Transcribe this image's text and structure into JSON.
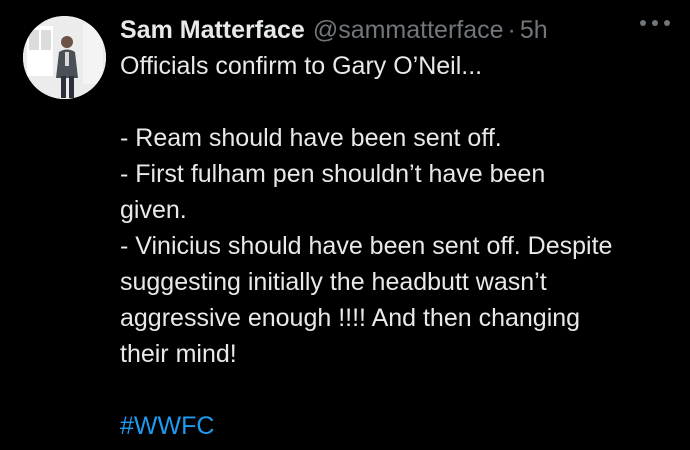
{
  "tweet": {
    "author_name": "Sam Matterface",
    "handle": "@sammatterface",
    "separator": "·",
    "time": "5h",
    "more_icon": "more-horizontal-icon",
    "lines": [
      "Officials confirm to Gary O’Neil...",
      "",
      "- Ream should have been sent off.",
      "- First fulham pen shouldn’t have been",
      "given.",
      "- Vinicius should have been sent off. Despite",
      "suggesting initially the headbutt wasn’t",
      "aggressive enough !!!! And then changing",
      "their mind!",
      ""
    ],
    "hashtag": "#WWFC"
  },
  "colors": {
    "background": "#000000",
    "text_primary": "#e7e9ea",
    "text_secondary": "#71767b",
    "link": "#1d9bf0"
  }
}
